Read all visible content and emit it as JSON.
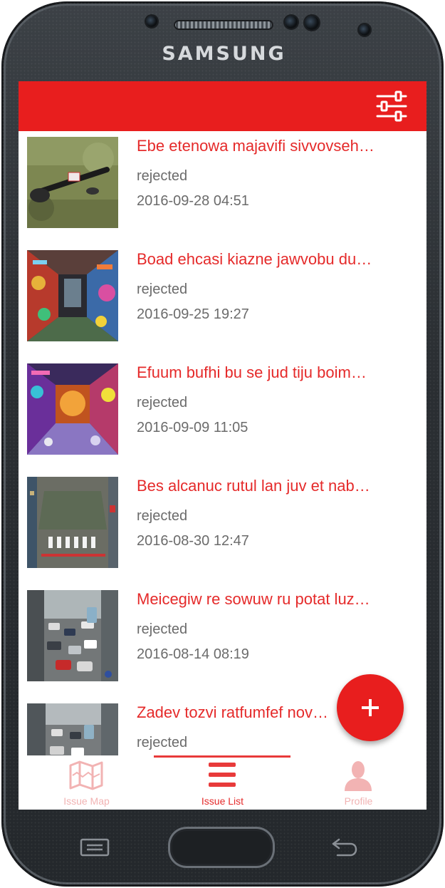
{
  "device": {
    "brand": "SAMSUNG"
  },
  "colors": {
    "accent": "#e81e1e",
    "title_text": "#e52a2a",
    "meta_text": "#6b6b6b",
    "inactive_tab": "#f2b3b3"
  },
  "header": {
    "filter_icon": "sliders-icon"
  },
  "issues": [
    {
      "title": "Ebe etenowa majavifi sivvovseh…",
      "status": "rejected",
      "date": "2016-09-28 04:51"
    },
    {
      "title": "Boad ehcasi kiazne jawvobu du…",
      "status": "rejected",
      "date": "2016-09-25 19:27"
    },
    {
      "title": "Efuum bufhi bu se jud tiju boim…",
      "status": "rejected",
      "date": "2016-09-09 11:05"
    },
    {
      "title": "Bes alcanuc rutul lan juv et nab…",
      "status": "rejected",
      "date": "2016-08-30 12:47"
    },
    {
      "title": "Meicegiw re sowuw ru potat luz…",
      "status": "rejected",
      "date": "2016-08-14 08:19"
    },
    {
      "title": "Zadev tozvi ratfumfef nov…",
      "status": "rejected",
      "date": ""
    }
  ],
  "fab": {
    "icon": "plus-icon"
  },
  "bottom_nav": {
    "tabs": [
      {
        "label": "Issue Map",
        "icon": "map-icon",
        "active": false
      },
      {
        "label": "Issue List",
        "icon": "list-icon",
        "active": true
      },
      {
        "label": "Profile",
        "icon": "person-icon",
        "active": false
      }
    ]
  }
}
